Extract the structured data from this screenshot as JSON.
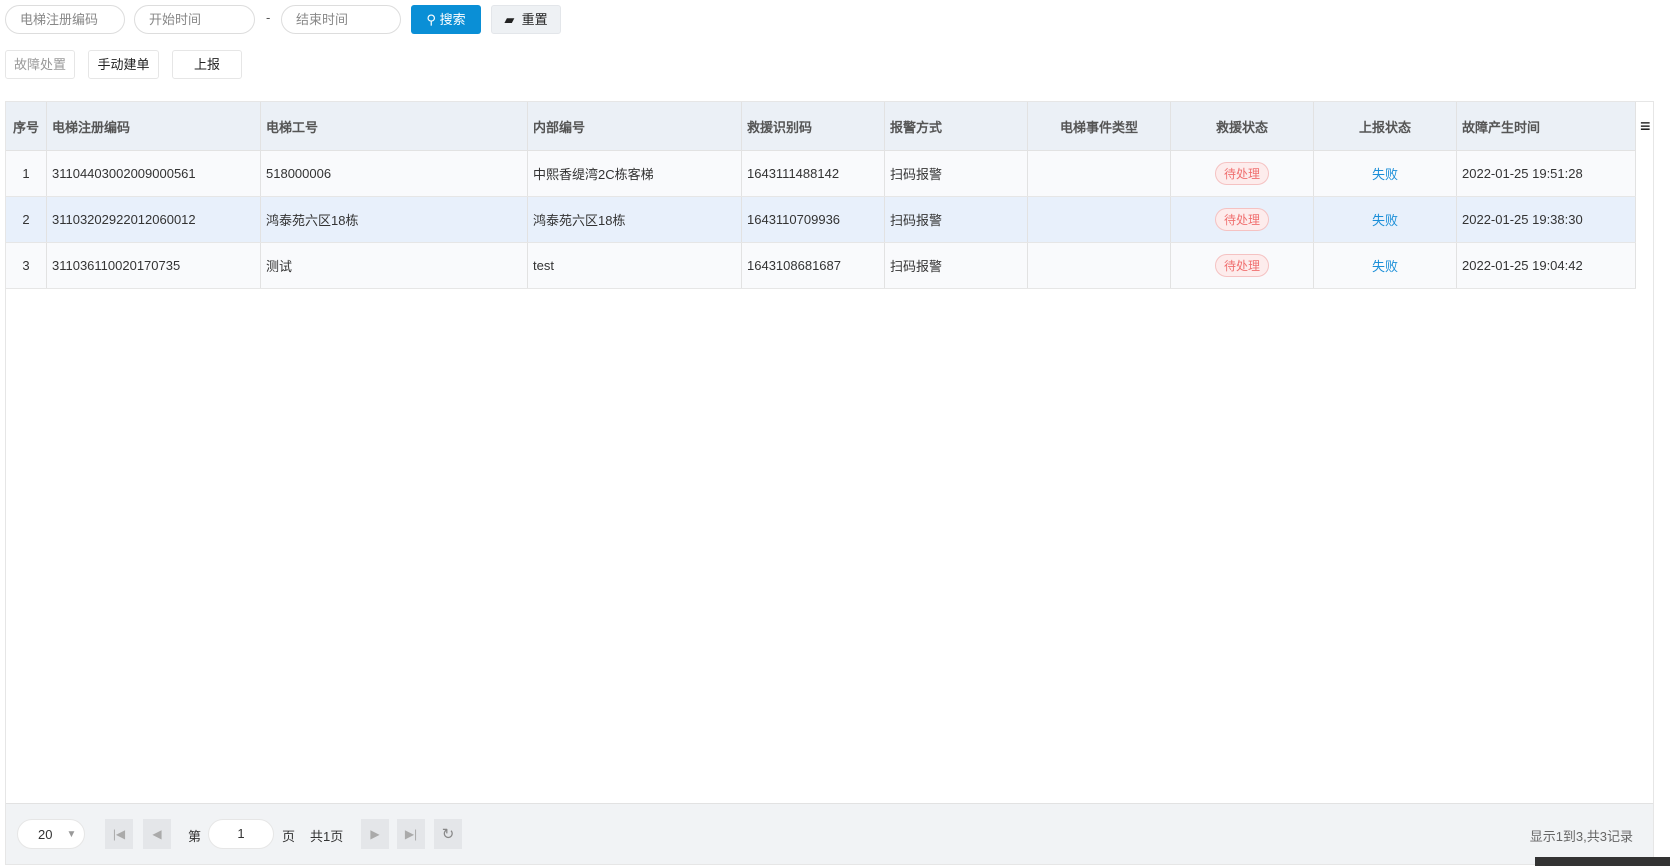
{
  "search": {
    "reg_code_placeholder": "电梯注册编码",
    "start_placeholder": "开始时间",
    "dash": "-",
    "end_placeholder": "结束时间",
    "search_label": "搜索",
    "reset_label": "重置"
  },
  "actions": {
    "fault": "故障处置",
    "manual": "手动建单",
    "report": "上报"
  },
  "table": {
    "columns": [
      "序号",
      "电梯注册编码",
      "电梯工号",
      "内部编号",
      "救援识别码",
      "报警方式",
      "电梯事件类型",
      "救援状态",
      "上报状态",
      "故障产生时间"
    ],
    "rows": [
      [
        "1",
        "31104403002009000561",
        "518000006",
        "中熙香缇湾2C栋客梯",
        "1643111488142",
        "扫码报警",
        "",
        "待处理",
        "失败",
        "2022-01-25 19:51:28"
      ],
      [
        "2",
        "31103202922012060012",
        "鸿泰苑六区18栋",
        "鸿泰苑六区18栋",
        "1643110709936",
        "扫码报警",
        "",
        "待处理",
        "失败",
        "2022-01-25 19:38:30"
      ],
      [
        "3",
        "311036110020170735",
        "测试",
        "test",
        "1643108681687",
        "扫码报警",
        "",
        "待处理",
        "失败",
        "2022-01-25 19:04:42"
      ]
    ]
  },
  "pager": {
    "page_size": "20",
    "prefix": "第",
    "page": "1",
    "suffix": "页",
    "total_pages": "共1页",
    "summary": "显示1到3,共3记录"
  },
  "colors": {
    "accent": "#0a8fd6",
    "badge": "#f07070"
  }
}
